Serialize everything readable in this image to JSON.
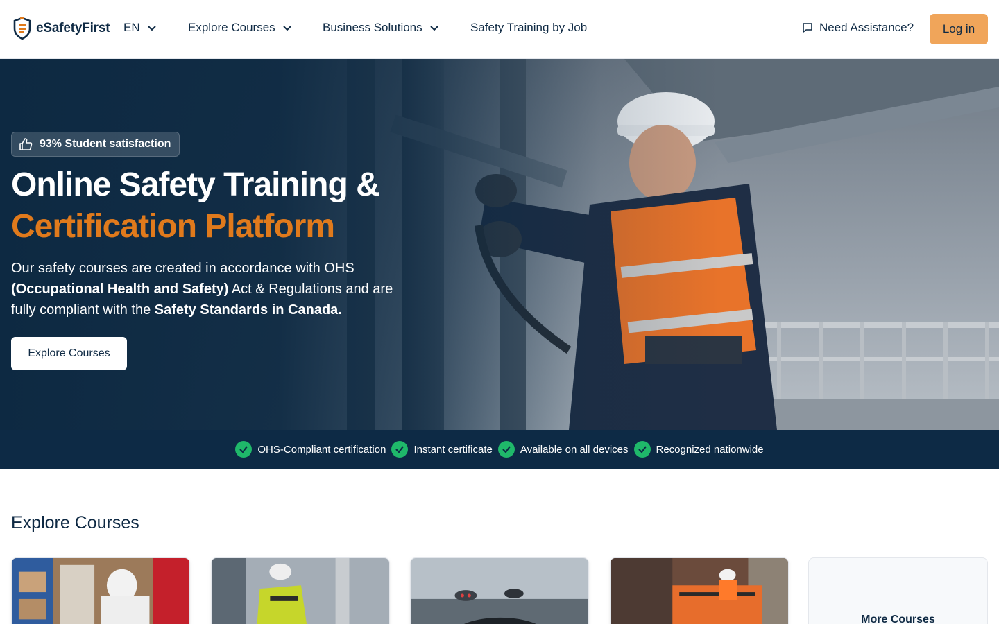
{
  "brand": {
    "name": "eSafetyFirst",
    "accent": "#e07a1c",
    "navy": "#0f2a44",
    "login_bg": "#f0a55a",
    "check_green": "#1fb86a"
  },
  "header": {
    "language": "EN",
    "nav": [
      {
        "label": "Explore Courses",
        "has_dropdown": true
      },
      {
        "label": "Business Solutions",
        "has_dropdown": true
      },
      {
        "label": "Safety Training by Job",
        "has_dropdown": false
      }
    ],
    "assist_label": "Need Assistance?",
    "assist_icon": "chat-icon",
    "login_label": "Log in"
  },
  "hero": {
    "badge": "93% Student satisfaction",
    "badge_icon": "thumbs-up-icon",
    "title_line1": "Online Safety Training &",
    "title_line2": "Certification Platform",
    "desc": {
      "p1": "Our safety courses are created in accordance with OHS ",
      "b1": "(Occupational Health and Safety)",
      "p2": " Act & Regulations and are fully compliant with the ",
      "b2": "Safety Standards in Canada."
    },
    "cta_label": "Explore Courses"
  },
  "features": [
    "OHS-Compliant certification",
    "Instant certificate",
    "Available on all devices",
    "Recognized nationwide"
  ],
  "courses": {
    "title": "Explore Courses",
    "more_label": "More Courses"
  }
}
